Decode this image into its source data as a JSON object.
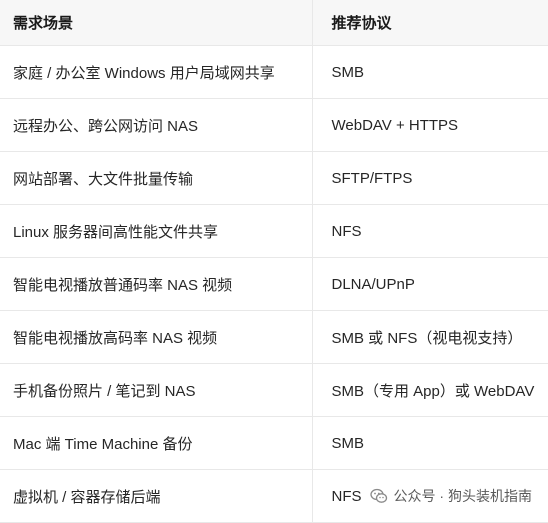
{
  "table": {
    "headers": [
      "需求场景",
      "推荐协议"
    ],
    "rows": [
      [
        "家庭 / 办公室 Windows 用户局域网共享",
        "SMB"
      ],
      [
        "远程办公、跨公网访问 NAS",
        "WebDAV + HTTPS"
      ],
      [
        "网站部署、大文件批量传输",
        "SFTP/FTPS"
      ],
      [
        "Linux 服务器间高性能文件共享",
        "NFS"
      ],
      [
        "智能电视播放普通码率 NAS 视频",
        "DLNA/UPnP"
      ],
      [
        "智能电视播放高码率 NAS 视频",
        "SMB 或 NFS（视电视支持）"
      ],
      [
        "手机备份照片 / 笔记到 NAS",
        "SMB（专用 App）或 WebDAV"
      ],
      [
        "Mac 端 Time Machine 备份",
        "SMB"
      ],
      [
        "虚拟机 / 容器存储后端",
        "NFS"
      ]
    ]
  },
  "watermark": {
    "text": "公众号 · 狗头装机指南",
    "icon": "wechat-icon",
    "color": "#8a8a8a"
  }
}
